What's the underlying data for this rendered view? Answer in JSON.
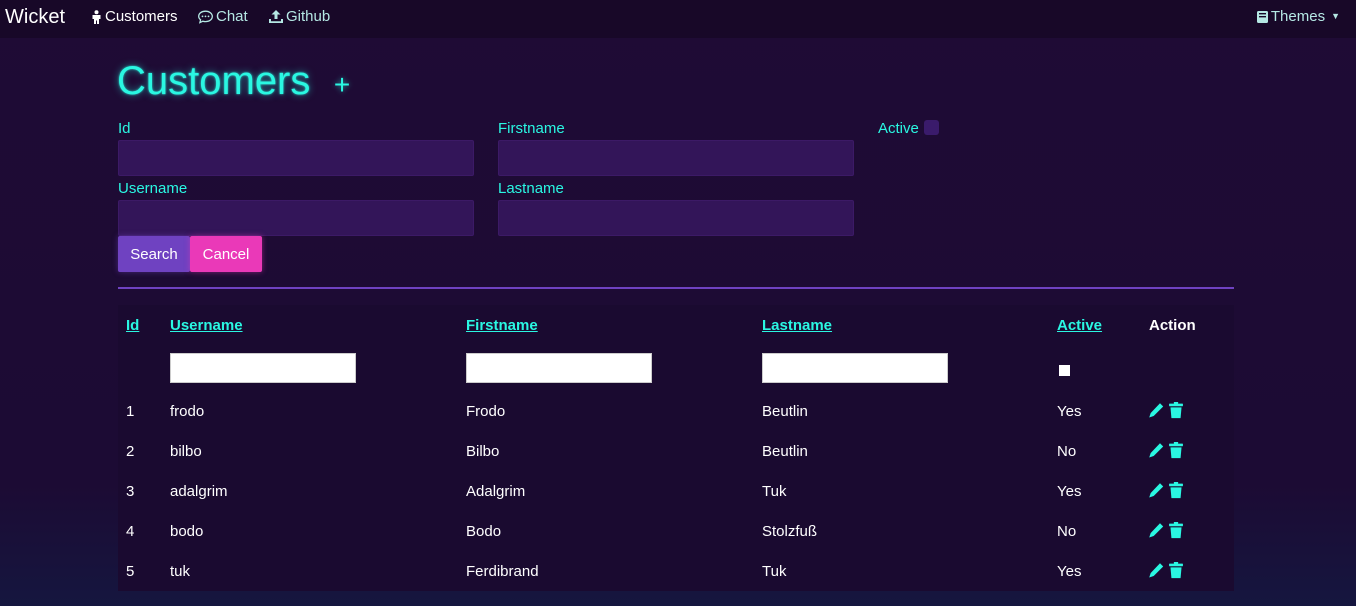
{
  "nav": {
    "brand": "Wicket",
    "links": [
      {
        "label": "Customers",
        "icon": "person-icon"
      },
      {
        "label": "Chat",
        "icon": "chat-icon"
      },
      {
        "label": "Github",
        "icon": "upload-icon"
      }
    ],
    "themes_label": "Themes"
  },
  "page": {
    "title": "Customers",
    "add_label": "+"
  },
  "search_form": {
    "id_label": "Id",
    "firstname_label": "Firstname",
    "active_label": "Active",
    "username_label": "Username",
    "lastname_label": "Lastname",
    "search_button": "Search",
    "cancel_button": "Cancel"
  },
  "table": {
    "headers": {
      "id": "Id",
      "username": "Username",
      "firstname": "Firstname",
      "lastname": "Lastname",
      "active": "Active",
      "action": "Action"
    },
    "rows": [
      {
        "id": "1",
        "username": "frodo",
        "firstname": "Frodo",
        "lastname": "Beutlin",
        "active": "Yes"
      },
      {
        "id": "2",
        "username": "bilbo",
        "firstname": "Bilbo",
        "lastname": "Beutlin",
        "active": "No"
      },
      {
        "id": "3",
        "username": "adalgrim",
        "firstname": "Adalgrim",
        "lastname": "Tuk",
        "active": "Yes"
      },
      {
        "id": "4",
        "username": "bodo",
        "firstname": "Bodo",
        "lastname": "Stolzfuß",
        "active": "No"
      },
      {
        "id": "5",
        "username": "tuk",
        "firstname": "Ferdibrand",
        "lastname": "Tuk",
        "active": "Yes"
      }
    ]
  },
  "colors": {
    "accent": "#2af7e2",
    "primary_button": "#6f42c1",
    "cancel_button": "#ea39b8",
    "background": "#1f0b35",
    "input_background": "#331559"
  }
}
